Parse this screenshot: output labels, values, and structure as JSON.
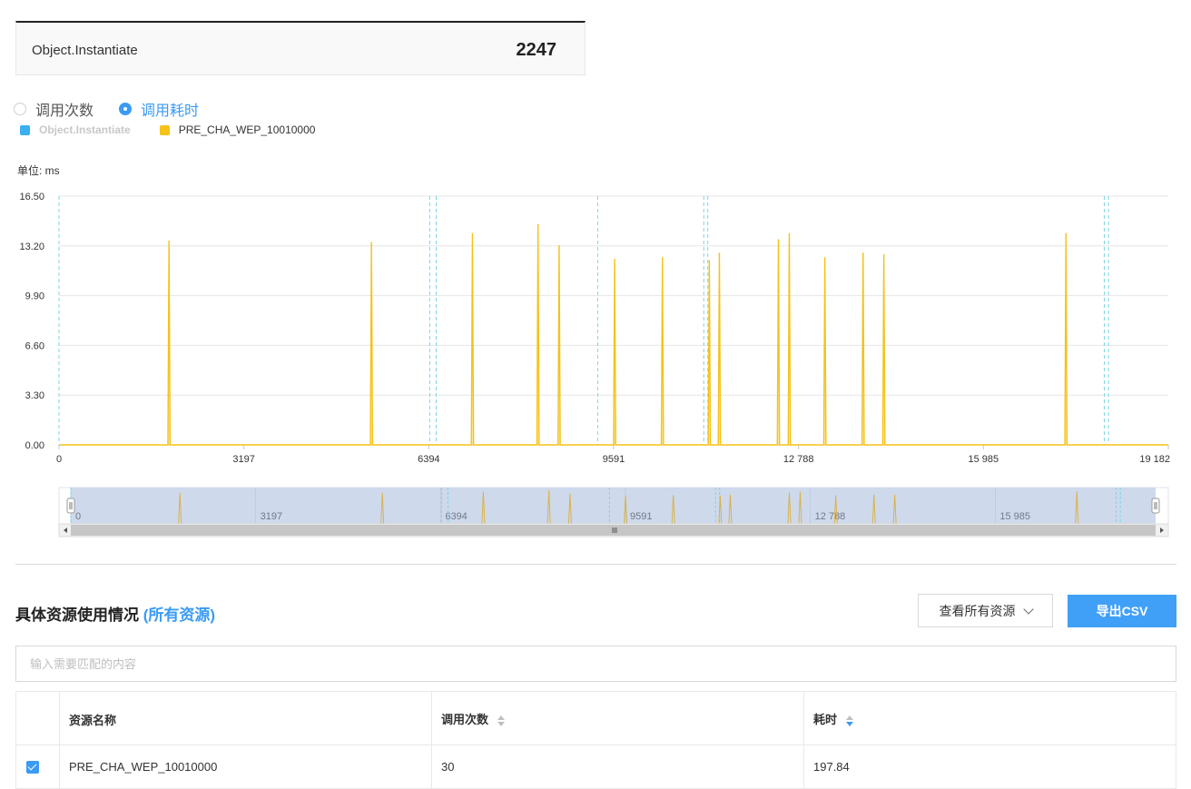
{
  "summary": {
    "label": "Object.Instantiate",
    "value": "2247"
  },
  "radios": [
    {
      "label": "调用次数",
      "checked": false
    },
    {
      "label": "调用耗时",
      "checked": true
    }
  ],
  "legend": [
    {
      "label": "Object.Instantiate",
      "color": "#3ab0f0",
      "active": false
    },
    {
      "label": "PRE_CHA_WEP_10010000",
      "color": "#f5c218",
      "active": true
    }
  ],
  "unit_label": "单位: ms",
  "chart_data": {
    "type": "line",
    "ylim": [
      0,
      16.5
    ],
    "y_ticks": [
      "16.50",
      "13.20",
      "9.90",
      "6.60",
      "3.30",
      "0.00"
    ],
    "xlim": [
      0,
      19182
    ],
    "x_ticks": [
      {
        "v": 0,
        "label": "0"
      },
      {
        "v": 3197,
        "label": "3197"
      },
      {
        "v": 6394,
        "label": "6394"
      },
      {
        "v": 9591,
        "label": "9591"
      },
      {
        "v": 12788,
        "label": "12 788"
      },
      {
        "v": 15985,
        "label": "15 985"
      },
      {
        "v": 19182,
        "label": "19 182"
      }
    ],
    "series": [
      {
        "name": "PRE_CHA_WEP_10010000",
        "color": "#f5c218",
        "spikes": [
          [
            1902,
            13.5
          ],
          [
            5403,
            13.4
          ],
          [
            7149,
            14.0
          ],
          [
            8283,
            14.6
          ],
          [
            8648,
            13.2
          ],
          [
            9608,
            12.3
          ],
          [
            10434,
            12.4
          ],
          [
            11245,
            12.2
          ],
          [
            11419,
            12.7
          ],
          [
            12440,
            13.6
          ],
          [
            12628,
            14.0
          ],
          [
            13243,
            12.4
          ],
          [
            13904,
            12.7
          ],
          [
            14263,
            12.6
          ],
          [
            17412,
            14.0
          ]
        ]
      }
    ],
    "markers": [
      0,
      6411,
      6522,
      9315,
      11149,
      11219,
      18075,
      18148
    ],
    "zoom_ticks": [
      {
        "v": 0,
        "label": "0"
      },
      {
        "v": 3197,
        "label": "3197"
      },
      {
        "v": 6394,
        "label": "6394"
      },
      {
        "v": 9591,
        "label": "9591"
      },
      {
        "v": 12788,
        "label": "12 788"
      },
      {
        "v": 15985,
        "label": "15 985"
      }
    ]
  },
  "section": {
    "title": "具体资源使用情况",
    "link": "(所有资源)"
  },
  "view_button": {
    "label": "查看所有资源"
  },
  "export_button": {
    "label": "导出CSV"
  },
  "search": {
    "placeholder": "输入需要匹配的内容",
    "value": ""
  },
  "table": {
    "headers": {
      "name": "资源名称",
      "count": "调用次数",
      "time": "耗时"
    },
    "rows": [
      {
        "checked": true,
        "name": "PRE_CHA_WEP_10010000",
        "count": "30",
        "time": "197.84"
      }
    ]
  },
  "colors": {
    "accent": "#3a9bf4",
    "series": "#f5c218",
    "marker": "#7fd4e3"
  }
}
